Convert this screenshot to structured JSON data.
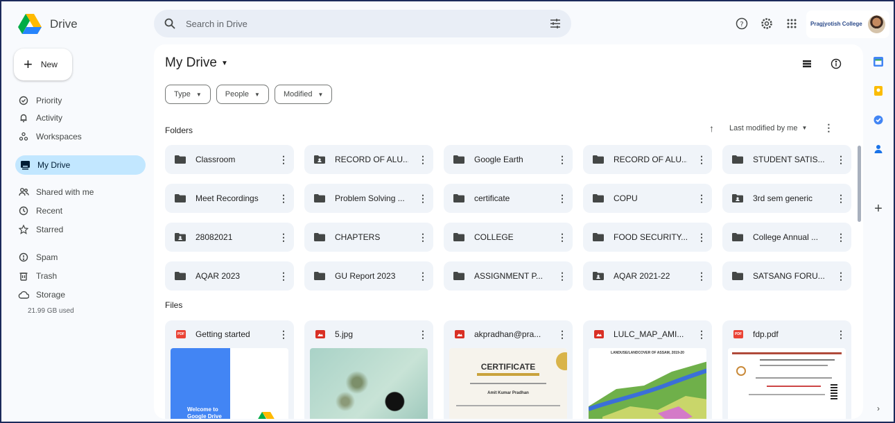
{
  "app": {
    "name": "Drive"
  },
  "search": {
    "placeholder": "Search in Drive"
  },
  "header": {
    "org_label": "Pragjyotish College"
  },
  "sidebar": {
    "new_label": "New",
    "items": [
      {
        "label": "Priority",
        "icon": "priority-icon"
      },
      {
        "label": "Activity",
        "icon": "activity-icon"
      },
      {
        "label": "Workspaces",
        "icon": "workspaces-icon"
      },
      {
        "label": "My Drive",
        "icon": "my-drive-icon"
      },
      {
        "label": "Shared with me",
        "icon": "shared-icon"
      },
      {
        "label": "Recent",
        "icon": "clock-icon"
      },
      {
        "label": "Starred",
        "icon": "star-icon"
      },
      {
        "label": "Spam",
        "icon": "spam-icon"
      },
      {
        "label": "Trash",
        "icon": "trash-icon"
      },
      {
        "label": "Storage",
        "icon": "cloud-icon"
      }
    ],
    "storage_used": "21.99 GB used"
  },
  "main": {
    "title": "My Drive",
    "filters": [
      "Type",
      "People",
      "Modified"
    ],
    "folders_label": "Folders",
    "files_label": "Files",
    "sort_label": "Last modified by me",
    "folders": [
      {
        "name": "Classroom",
        "shared": false
      },
      {
        "name": "RECORD OF ALU...",
        "shared": true
      },
      {
        "name": "Google Earth",
        "shared": false
      },
      {
        "name": "RECORD OF ALU...",
        "shared": false
      },
      {
        "name": "STUDENT SATIS...",
        "shared": false
      },
      {
        "name": "Meet Recordings",
        "shared": false
      },
      {
        "name": "Problem Solving ...",
        "shared": false
      },
      {
        "name": "certificate",
        "shared": false
      },
      {
        "name": "COPU",
        "shared": false
      },
      {
        "name": "3rd sem generic",
        "shared": true
      },
      {
        "name": "28082021",
        "shared": true
      },
      {
        "name": "CHAPTERS",
        "shared": false
      },
      {
        "name": "COLLEGE",
        "shared": false
      },
      {
        "name": "FOOD SECURITY...",
        "shared": false
      },
      {
        "name": "College Annual ...",
        "shared": false
      },
      {
        "name": "AQAR 2023",
        "shared": false
      },
      {
        "name": "GU Report 2023",
        "shared": false
      },
      {
        "name": "ASSIGNMENT P...",
        "shared": false
      },
      {
        "name": "AQAR 2021-22",
        "shared": true
      },
      {
        "name": "SATSANG FORU...",
        "shared": false
      }
    ],
    "files": [
      {
        "name": "Getting started",
        "type": "PDF",
        "thumb": "welcome",
        "thumb_text": "Welcome to Google Drive"
      },
      {
        "name": "5.jpg",
        "type": "IMG",
        "thumb": "micro"
      },
      {
        "name": "akpradhan@pra...",
        "type": "IMG",
        "thumb": "cert",
        "thumb_title": "CERTIFICATE",
        "thumb_sub": "Amit Kumar Pradhan"
      },
      {
        "name": "LULC_MAP_AMI...",
        "type": "IMG",
        "thumb": "map",
        "thumb_title": "LANDUSE/LANDCOVER OF ASSAM, 2019-20"
      },
      {
        "name": "fdp.pdf",
        "type": "PDF",
        "thumb": "doc"
      }
    ]
  },
  "colors": {
    "accent": "#c2e7ff",
    "folder_bg": "#f0f4f9",
    "pdf": "#ea4335",
    "img": "#d93025"
  }
}
